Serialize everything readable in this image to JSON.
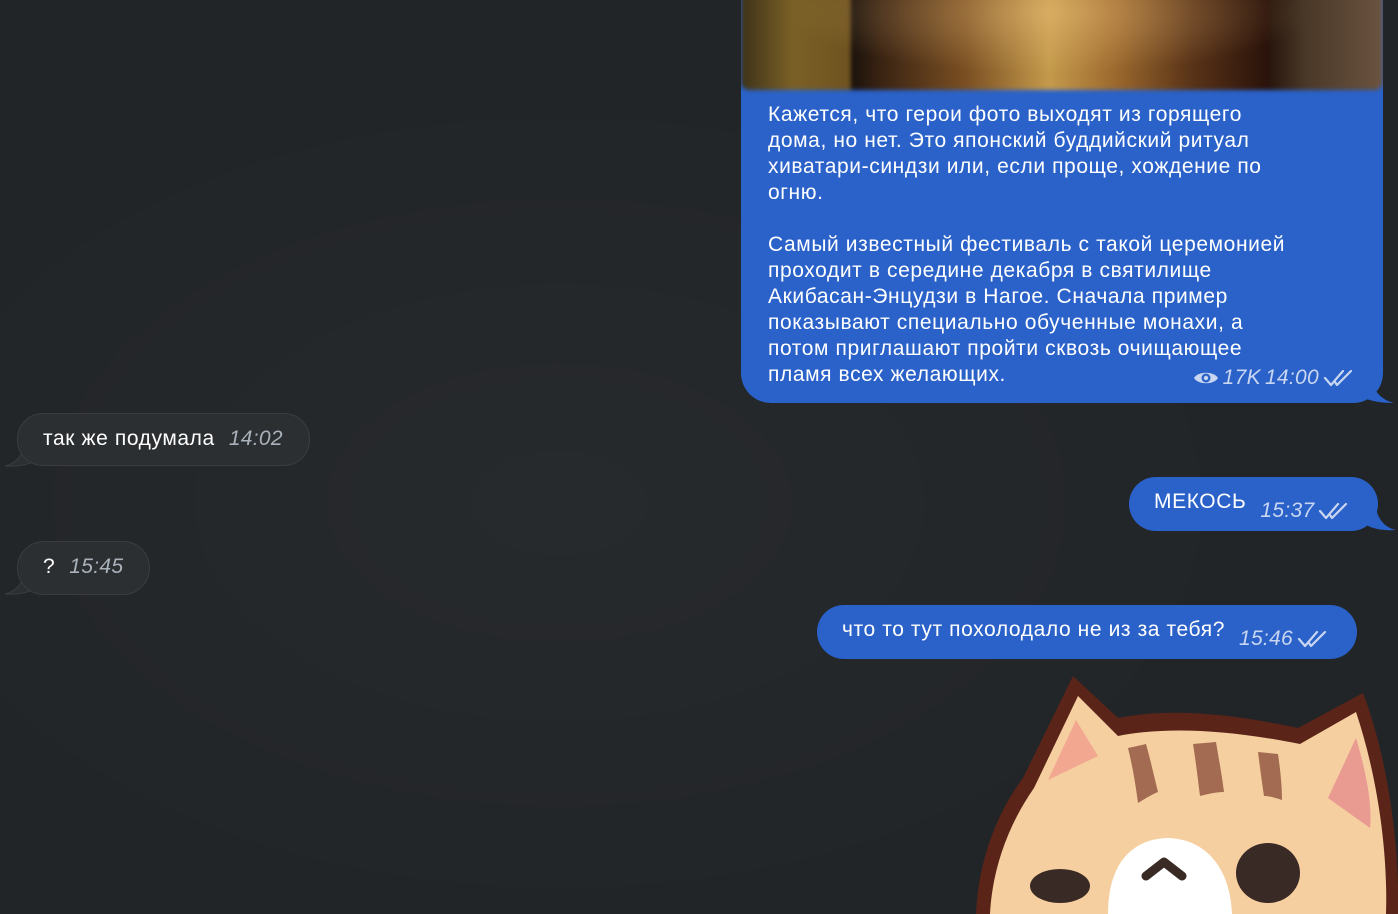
{
  "messages": {
    "post": {
      "text": "Кажется, что герои фото выходят из горящего\nдома, но нет. Это японский буддийский ритуал\nхиватари-синдзи или, если проще, хождение по\nогню.\n\nСамый известный фестиваль с такой церемонией\nпроходит в середине декабря в святилище\nАкибасан-Энцудзи в Нагое. Сначала пример\nпоказывают специально обученные монахи, а\nпотом приглашают пройти сквозь очищающее\nпламя всех желающих.",
      "views": "17K",
      "time": "14:00",
      "status": "read"
    },
    "items": [
      {
        "text": "так же подумала",
        "time": "14:02",
        "direction": "incoming"
      },
      {
        "text": "МЕКОСЬ",
        "time": "15:37",
        "direction": "outgoing",
        "status": "read"
      },
      {
        "text": "?",
        "time": "15:45",
        "direction": "incoming"
      },
      {
        "text": "что то тут похолодало не из за тебя?",
        "time": "15:46",
        "direction": "outgoing",
        "status": "read"
      }
    ]
  },
  "icons": {
    "views": "eye-icon",
    "read": "double-check-icon",
    "sticker": "cat-sticker"
  },
  "colors": {
    "background": "#222528",
    "outgoing_bubble": "#2a62c9",
    "incoming_bubble": "#2c2f32"
  }
}
